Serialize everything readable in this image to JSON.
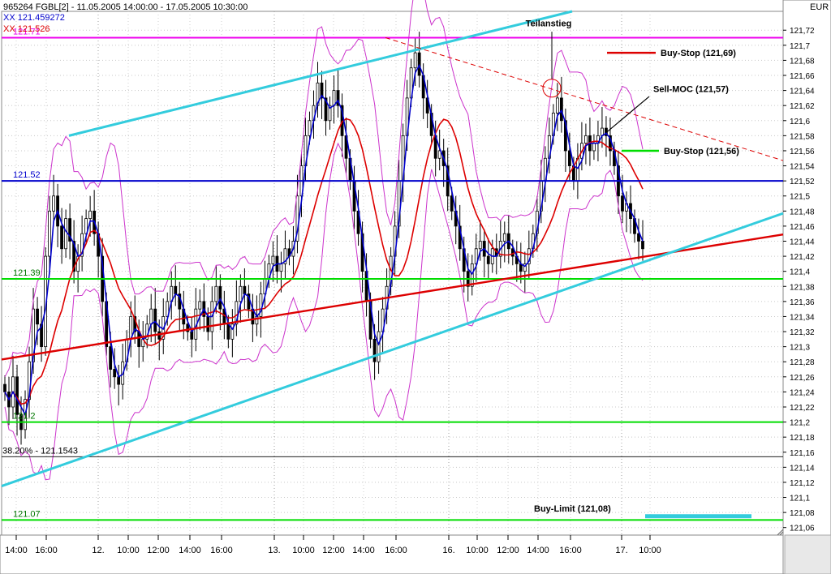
{
  "header": {
    "symbol_line": "965264  FGBL[2] - 11.05.2005 14:00:00 - 17.05.2005 10:30:00",
    "indicator_1": "XX 121.459272",
    "indicator_2": "XX 121.526",
    "currency": "EUR"
  },
  "colors": {
    "candle": "#000000",
    "ma_fast": "#0000cc",
    "ma_slow": "#dd0000",
    "bands": "#cc33cc",
    "channel": "#33ccdd",
    "level_green": "#00dd00",
    "level_blue": "#0000cc",
    "level_magenta": "#ee00ee",
    "trend_red": "#dd0000"
  },
  "chart_data": {
    "type": "candlestick",
    "ylim": [
      121.05,
      121.745
    ],
    "y_ticks": [
      "121,06",
      "121,08",
      "121,1",
      "121,12",
      "121,14",
      "121,16",
      "121,18",
      "121,2",
      "121,22",
      "121,24",
      "121,26",
      "121,28",
      "121,3",
      "121,32",
      "121,34",
      "121,36",
      "121,38",
      "121,4",
      "121,42",
      "121,44",
      "121,46",
      "121,48",
      "121,5",
      "121,52",
      "121,54",
      "121,56",
      "121,58",
      "121,6",
      "121,62",
      "121,64",
      "121,66",
      "121,68",
      "121,7",
      "121,72"
    ],
    "x_labels": [
      "14:00",
      "16:00",
      "12.",
      "10:00",
      "12:00",
      "14:00",
      "16:00",
      "13.",
      "10:00",
      "12:00",
      "14:00",
      "16:00",
      "16.",
      "10:00",
      "12:00",
      "14:00",
      "16:00",
      "17.",
      "10:00"
    ],
    "levels": [
      {
        "value": 121.71,
        "label": "121.71",
        "color": "#ee00ee"
      },
      {
        "value": 121.52,
        "label": "121.52",
        "color": "#0000cc"
      },
      {
        "value": 121.39,
        "label": "121.39",
        "color": "#00dd00"
      },
      {
        "value": 121.2,
        "label": "121.2",
        "color": "#00dd00"
      },
      {
        "value": 121.07,
        "label": "121.07",
        "color": "#00dd00"
      },
      {
        "value": 121.154,
        "label": "38.20% - 121.1543",
        "color": "#000000"
      }
    ],
    "annotations": {
      "teilanstieg": "Teilanstieg",
      "buy_stop_1": "Buy-Stop (121,69)",
      "sell_moc": "Sell-MOC (121,57)",
      "buy_stop_2": "Buy-Stop (121,56)",
      "buy_limit": "Buy-Limit (121,08)"
    },
    "series": {
      "close": [
        121.24,
        121.22,
        121.26,
        121.21,
        121.19,
        121.23,
        121.28,
        121.35,
        121.33,
        121.3,
        121.42,
        121.48,
        121.5,
        121.46,
        121.43,
        121.47,
        121.44,
        121.4,
        121.42,
        121.45,
        121.47,
        121.48,
        121.45,
        121.42,
        121.36,
        121.3,
        121.27,
        121.26,
        121.25,
        121.28,
        121.31,
        121.34,
        121.32,
        121.3,
        121.31,
        121.33,
        121.35,
        121.32,
        121.31,
        121.34,
        121.36,
        121.38,
        121.37,
        121.35,
        121.33,
        121.32,
        121.31,
        121.35,
        121.36,
        121.34,
        121.32,
        121.36,
        121.38,
        121.35,
        121.33,
        121.31,
        121.33,
        121.36,
        121.38,
        121.37,
        121.35,
        121.33,
        121.34,
        121.37,
        121.39,
        121.41,
        121.42,
        121.4,
        121.41,
        121.43,
        121.42,
        121.44,
        121.5,
        121.54,
        121.58,
        121.6,
        121.62,
        121.65,
        121.63,
        121.6,
        121.62,
        121.64,
        121.62,
        121.58,
        121.55,
        121.52,
        121.48,
        121.45,
        121.4,
        121.36,
        121.31,
        121.28,
        121.32,
        121.35,
        121.38,
        121.42,
        121.46,
        121.52,
        121.58,
        121.63,
        121.67,
        121.69,
        121.66,
        121.63,
        121.61,
        121.58,
        121.55,
        121.56,
        121.54,
        121.5,
        121.48,
        121.46,
        121.43,
        121.4,
        121.38,
        121.41,
        121.43,
        121.44,
        121.42,
        121.41,
        121.43,
        121.42,
        121.44,
        121.45,
        121.43,
        121.42,
        121.41,
        121.4,
        121.41,
        121.43,
        121.45,
        121.48,
        121.52,
        121.55,
        121.58,
        121.61,
        121.63,
        121.6,
        121.56,
        121.54,
        121.52,
        121.55,
        121.57,
        121.58,
        121.56,
        121.57,
        121.58,
        121.59,
        121.58,
        121.56,
        121.54,
        121.5,
        121.48,
        121.49,
        121.47,
        121.45,
        121.44,
        121.43
      ]
    }
  }
}
